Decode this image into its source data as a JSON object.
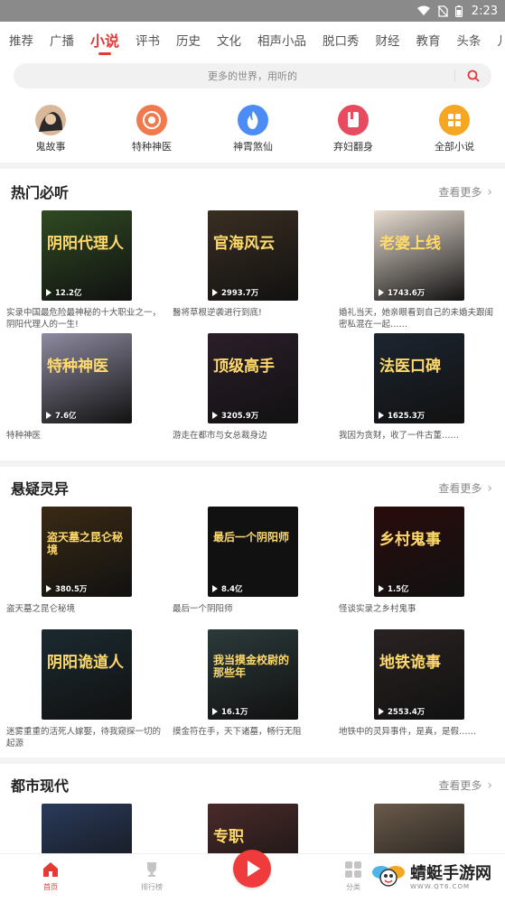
{
  "status_bar": {
    "time": "2:23"
  },
  "tabs": [
    "推荐",
    "广播",
    "小说",
    "评书",
    "历史",
    "文化",
    "相声小品",
    "脱口秀",
    "财经",
    "教育",
    "头条",
    "儿"
  ],
  "active_tab_index": 2,
  "search": {
    "placeholder": "更多的世界，用听的"
  },
  "quick_links": [
    {
      "label": "鬼故事",
      "icon": "ghost-avatar-icon",
      "color": "#333333"
    },
    {
      "label": "特种神医",
      "icon": "medal-icon",
      "color": "#f07a4e"
    },
    {
      "label": "神霄煞仙",
      "icon": "flame-icon",
      "color": "#4c8df5"
    },
    {
      "label": "弃妇翻身",
      "icon": "book-icon",
      "color": "#e84a5f"
    },
    {
      "label": "全部小说",
      "icon": "grid-icon",
      "color": "#f5a623"
    }
  ],
  "sections": [
    {
      "title": "热门必听",
      "more": "查看更多",
      "items": [
        {
          "cover_text": "阴阳代理人",
          "plays": "12.2亿",
          "desc": "实录中国最危险最神秘的十大职业之一，阴阳代理人的一生!",
          "bg": "#2f4a22"
        },
        {
          "cover_text": "官海风云",
          "plays": "2993.7万",
          "desc": "醫将草根逆袭进行到底!",
          "bg": "#3a2e22"
        },
        {
          "cover_text": "老婆上线",
          "plays": "1743.6万",
          "desc": "婚礼当天，她亲眼看到自己的未婚夫跟闺密私混在一起……",
          "bg": "#e8ddd2"
        },
        {
          "cover_text": "特种神医",
          "plays": "7.6亿",
          "desc": "特种神医",
          "bg": "#8e8aa0"
        },
        {
          "cover_text": "顶级高手",
          "plays": "3205.9万",
          "desc": "游走在都市与女总裁身边",
          "bg": "#2b1e2a"
        },
        {
          "cover_text": "法医口碑",
          "plays": "1625.3万",
          "desc": "我因为贪财，收了一件古董……",
          "bg": "#1c2530"
        }
      ]
    },
    {
      "title": "悬疑灵异",
      "more": "查看更多",
      "items": [
        {
          "cover_text": "盗天墓之昆仑秘境",
          "plays": "380.5万",
          "desc": "盗天墓之昆仑秘境",
          "bg": "#3a2a14"
        },
        {
          "cover_text": "最后一个阴阳师",
          "plays": "8.4亿",
          "desc": "最后一个阴阳师",
          "bg": "#111111"
        },
        {
          "cover_text": "乡村鬼事",
          "plays": "1.5亿",
          "desc": "怪谈实录之乡村鬼事",
          "bg": "#2a0c0c"
        },
        {
          "cover_text": "阴阳诡道人",
          "plays": "",
          "desc": "迷雾重重的活死人嫁娶，待我窥探一切的起源",
          "bg": "#1b2a30"
        },
        {
          "cover_text": "我当摸金校尉的那些年",
          "plays": "16.1万",
          "desc": "摸金符在手，天下诸墓，畅行无阻",
          "bg": "#2c3a3a"
        },
        {
          "cover_text": "地铁诡事",
          "plays": "2553.4万",
          "desc": "地铁中的灵异事件，是真，是假……",
          "bg": "#2a2222"
        }
      ]
    },
    {
      "title": "都市现代",
      "more": "查看更多",
      "items": [
        {
          "cover_text": "",
          "plays": "",
          "desc": "",
          "bg": "#2a3a5a"
        },
        {
          "cover_text": "专职",
          "plays": "",
          "desc": "",
          "bg": "#4a2a2a"
        },
        {
          "cover_text": "",
          "plays": "",
          "desc": "",
          "bg": "#6a5a4a"
        }
      ]
    }
  ],
  "bottom_nav": [
    {
      "label": "首页",
      "icon": "home-icon"
    },
    {
      "label": "排行榜",
      "icon": "trophy-icon"
    },
    {
      "label": "分类",
      "icon": "category-icon"
    }
  ],
  "watermark": {
    "title": "蜻蜓手游网",
    "sub": "WWW.QT6.COM"
  }
}
